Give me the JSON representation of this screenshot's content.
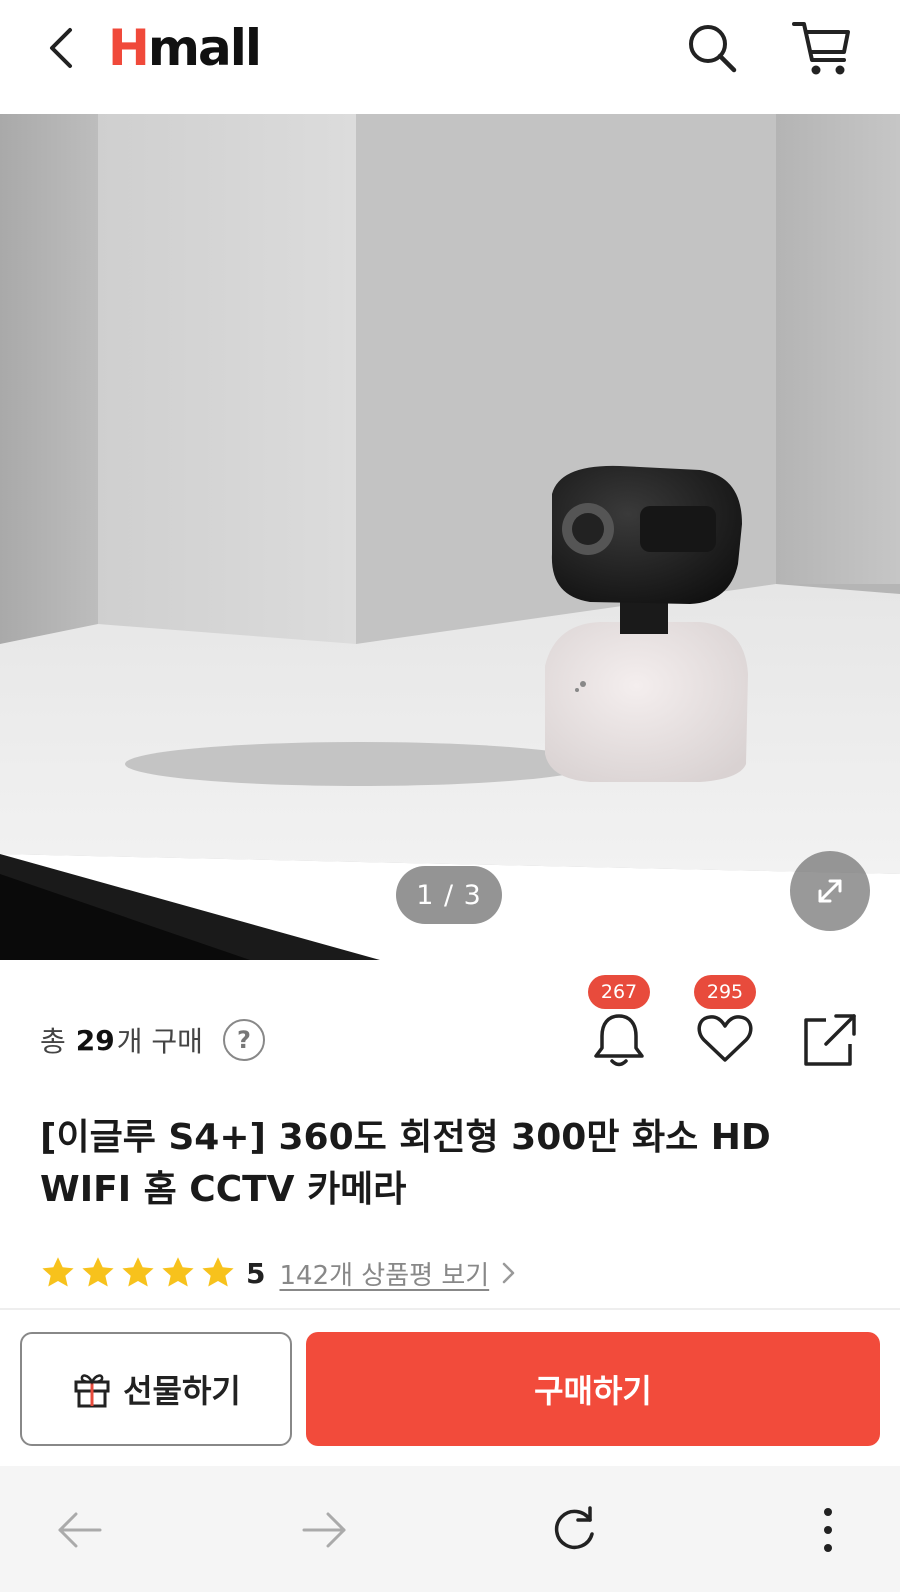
{
  "header": {
    "logo_h": "H",
    "logo_rest": "mall"
  },
  "gallery": {
    "pager": "1 / 3"
  },
  "purchase": {
    "prefix": "총",
    "count": "29",
    "suffix": "개 구매",
    "help": "?"
  },
  "actions": {
    "alarm_count": "267",
    "wish_count": "295"
  },
  "product": {
    "title": "[이글루 S4+] 360도 회전형 300만 화소 HD WIFI 홈 CCTV 카메라",
    "rating_score": "5",
    "stars": 5,
    "reviews_link": "142개 상품평 보기"
  },
  "buttons": {
    "gift": "선물하기",
    "buy": "구매하기"
  },
  "colors": {
    "accent": "#f24b3b",
    "star": "#f7c21c"
  }
}
